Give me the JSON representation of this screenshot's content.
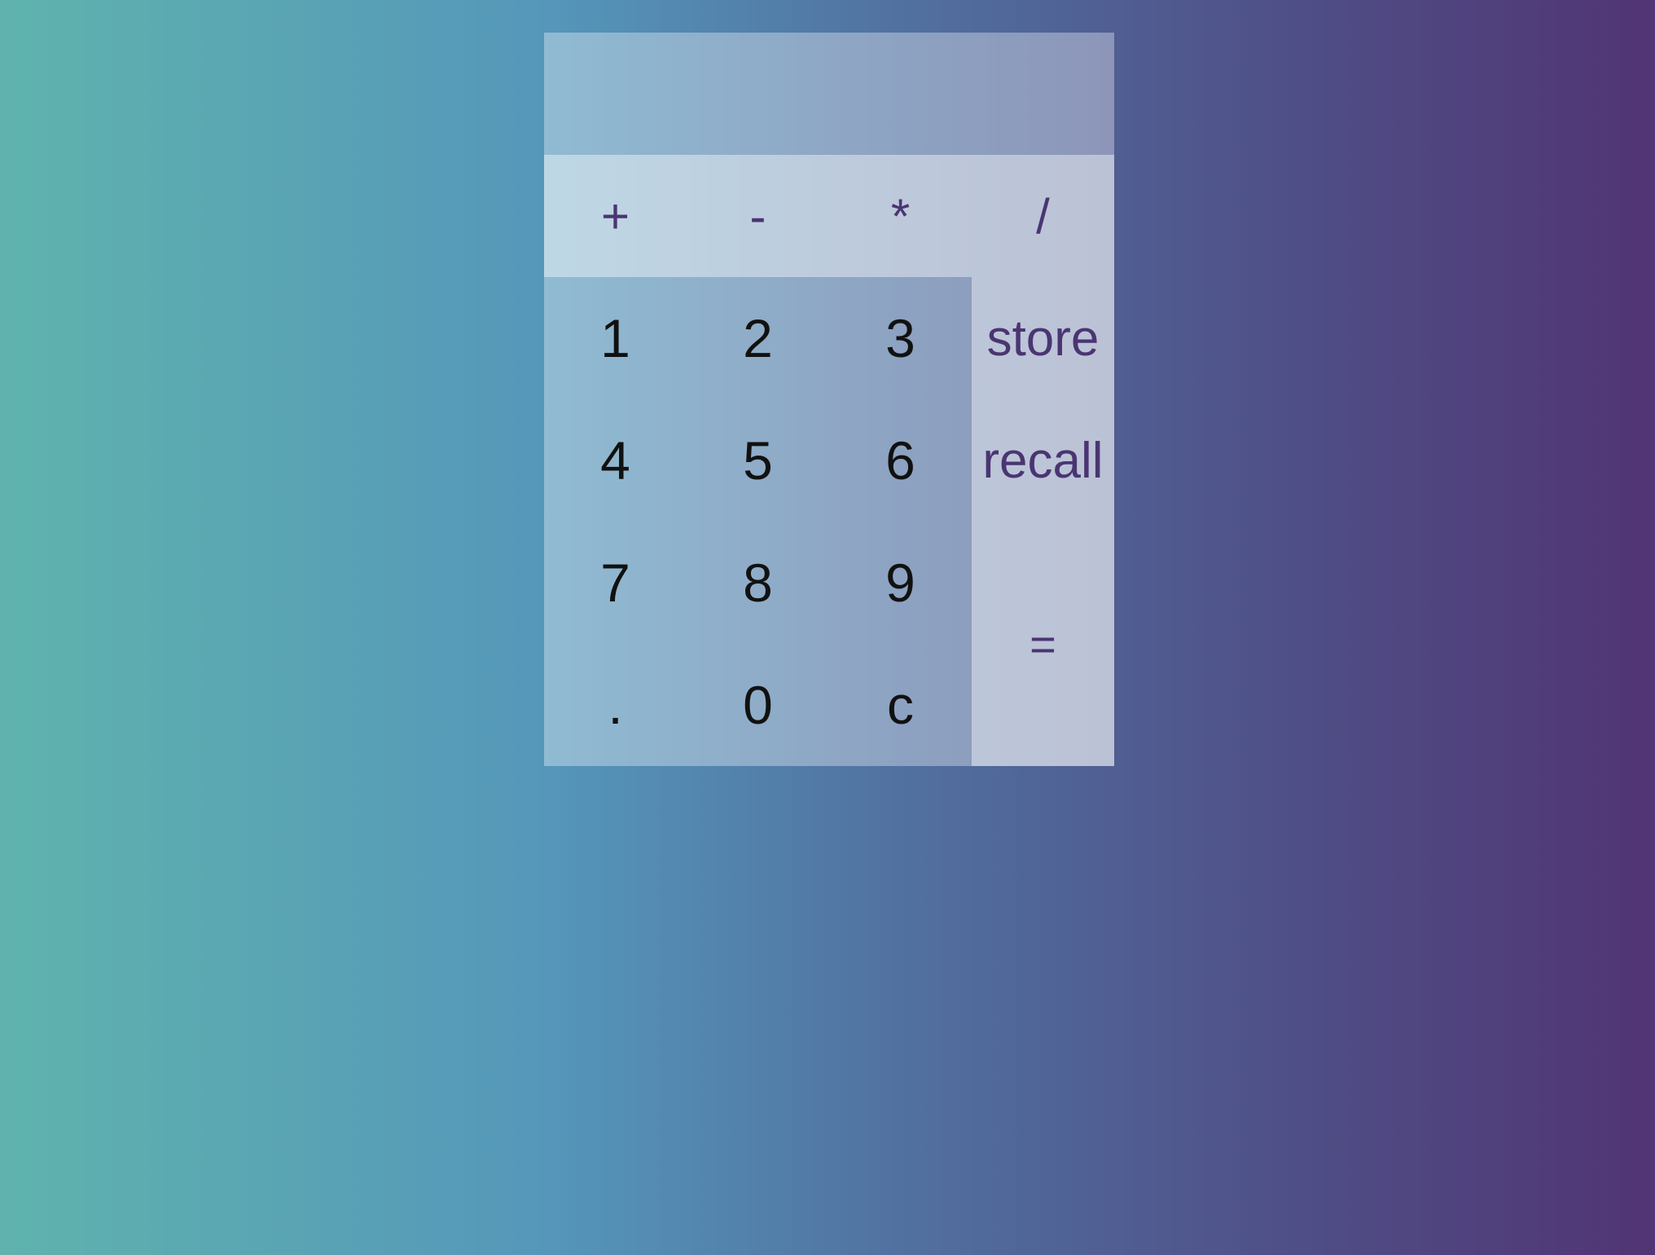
{
  "display": {
    "value": ""
  },
  "operators": [
    {
      "label": "+",
      "name": "plus-button"
    },
    {
      "label": "-",
      "name": "minus-button"
    },
    {
      "label": "*",
      "name": "multiply-button"
    },
    {
      "label": "/",
      "name": "divide-button"
    }
  ],
  "keys": {
    "k1": "1",
    "k2": "2",
    "k3": "3",
    "k4": "4",
    "k5": "5",
    "k6": "6",
    "k7": "7",
    "k8": "8",
    "k9": "9",
    "dot": ".",
    "k0": "0",
    "clear": "c"
  },
  "memory": {
    "store": "store",
    "recall": "recall"
  },
  "equals": "=",
  "colors": {
    "gradient_start": "#5fb3ad",
    "gradient_end": "#513473",
    "operator_text": "#4a3572",
    "digit_text": "#111111"
  }
}
